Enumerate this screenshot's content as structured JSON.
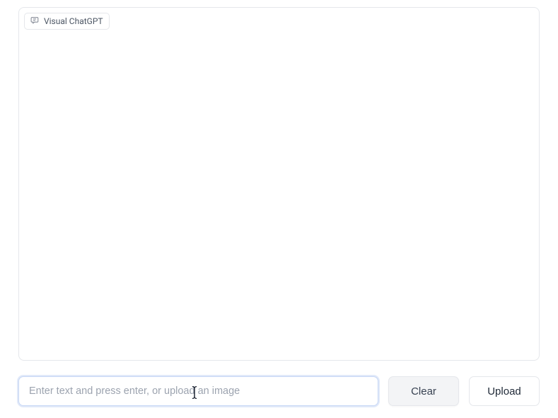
{
  "panel": {
    "title": "Visual ChatGPT"
  },
  "input": {
    "placeholder": "Enter text and press enter, or upload an image",
    "value": ""
  },
  "buttons": {
    "clear": "Clear",
    "upload": "Upload"
  }
}
